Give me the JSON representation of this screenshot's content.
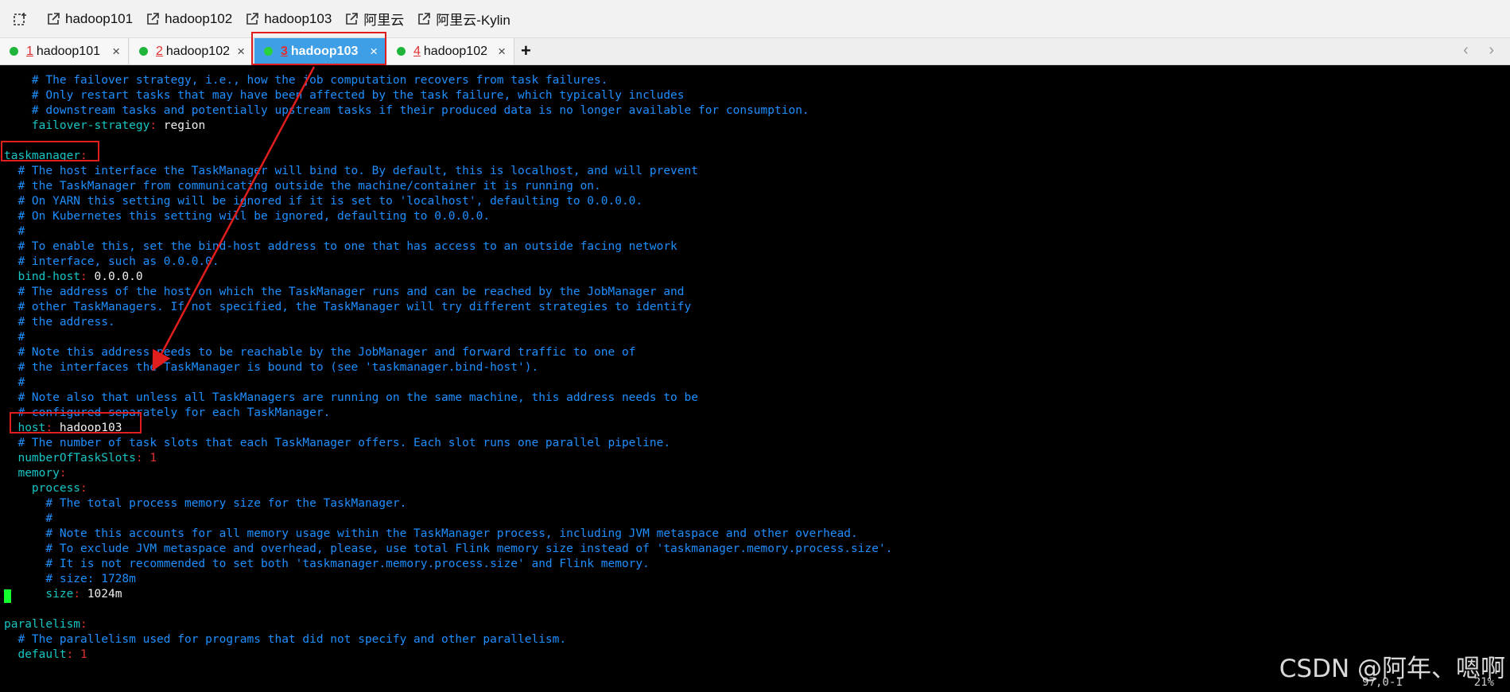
{
  "bookmarks": {
    "icon": "new-window-icon",
    "items": [
      "hadoop101",
      "hadoop102",
      "hadoop103",
      "阿里云",
      "阿里云-Kylin"
    ]
  },
  "tabs": [
    {
      "num": "1",
      "label": "hadoop101",
      "close": "×",
      "active": false
    },
    {
      "num": "2",
      "label": "hadoop102",
      "close": "×",
      "active": false
    },
    {
      "num": "3",
      "label": "hadoop103",
      "close": "×",
      "active": true
    },
    {
      "num": "4",
      "label": "hadoop102",
      "close": "×",
      "active": false
    }
  ],
  "tab_add": "+",
  "tab_nav": "‹ ›",
  "terminal_lines": [
    [
      [
        "cmt",
        "    # The failover strategy, i.e., how the job computation recovers from task failures."
      ]
    ],
    [
      [
        "cmt",
        "    # Only restart tasks that may have been affected by the task failure, which typically includes"
      ]
    ],
    [
      [
        "cmt",
        "    # downstream tasks and potentially upstream tasks if their produced data is no longer available for consumption."
      ]
    ],
    [
      [
        "key",
        "    failover-strategy"
      ],
      [
        "pun",
        ":"
      ],
      [
        "val",
        " region"
      ]
    ],
    [
      [
        "val",
        ""
      ]
    ],
    [
      [
        "key",
        "taskmanager"
      ],
      [
        "pun",
        ":"
      ]
    ],
    [
      [
        "cmt",
        "  # The host interface the TaskManager will bind to. By default, this is localhost, and will prevent"
      ]
    ],
    [
      [
        "cmt",
        "  # the TaskManager from communicating outside the machine/container it is running on."
      ]
    ],
    [
      [
        "cmt",
        "  # On YARN this setting will be ignored if it is set to 'localhost', defaulting to 0.0.0.0."
      ]
    ],
    [
      [
        "cmt",
        "  # On Kubernetes this setting will be ignored, defaulting to 0.0.0.0."
      ]
    ],
    [
      [
        "cmt",
        "  #"
      ]
    ],
    [
      [
        "cmt",
        "  # To enable this, set the bind-host address to one that has access to an outside facing network"
      ]
    ],
    [
      [
        "cmt",
        "  # interface, such as 0.0.0.0."
      ]
    ],
    [
      [
        "key",
        "  bind-host"
      ],
      [
        "pun",
        ":"
      ],
      [
        "val",
        " 0.0.0.0"
      ]
    ],
    [
      [
        "cmt",
        "  # The address of the host on which the TaskManager runs and can be reached by the JobManager and"
      ]
    ],
    [
      [
        "cmt",
        "  # other TaskManagers. If not specified, the TaskManager will try different strategies to identify"
      ]
    ],
    [
      [
        "cmt",
        "  # the address."
      ]
    ],
    [
      [
        "cmt",
        "  #"
      ]
    ],
    [
      [
        "cmt",
        "  # Note this address needs to be reachable by the JobManager and forward traffic to one of"
      ]
    ],
    [
      [
        "cmt",
        "  # the interfaces the TaskManager is bound to (see 'taskmanager.bind-host')."
      ]
    ],
    [
      [
        "cmt",
        "  #"
      ]
    ],
    [
      [
        "cmt",
        "  # Note also that unless all TaskManagers are running on the same machine, this address needs to be"
      ]
    ],
    [
      [
        "cmt",
        "  # configured separately for each TaskManager."
      ]
    ],
    [
      [
        "key",
        "  host"
      ],
      [
        "pun",
        ":"
      ],
      [
        "val",
        " hadoop103"
      ]
    ],
    [
      [
        "cmt",
        "  # The number of task slots that each TaskManager offers. Each slot runs one parallel pipeline."
      ]
    ],
    [
      [
        "key",
        "  numberOfTaskSlots"
      ],
      [
        "pun",
        ":"
      ],
      [
        "num",
        " 1"
      ]
    ],
    [
      [
        "key",
        "  memory"
      ],
      [
        "pun",
        ":"
      ]
    ],
    [
      [
        "key",
        "    process"
      ],
      [
        "pun",
        ":"
      ]
    ],
    [
      [
        "cmt",
        "      # The total process memory size for the TaskManager."
      ]
    ],
    [
      [
        "cmt",
        "      #"
      ]
    ],
    [
      [
        "cmt",
        "      # Note this accounts for all memory usage within the TaskManager process, including JVM metaspace and other overhead."
      ]
    ],
    [
      [
        "cmt",
        "      # To exclude JVM metaspace and overhead, please, use total Flink memory size instead of 'taskmanager.memory.process.size'."
      ]
    ],
    [
      [
        "cmt",
        "      # It is not recommended to set both 'taskmanager.memory.process.size' and Flink memory."
      ]
    ],
    [
      [
        "cmt",
        "      # size: 1728m"
      ]
    ],
    [
      [
        "key",
        "      size"
      ],
      [
        "pun",
        ":"
      ],
      [
        "val",
        " 1024m"
      ]
    ],
    [
      [
        "val",
        ""
      ]
    ],
    [
      [
        "key",
        "parallelism"
      ],
      [
        "pun",
        ":"
      ]
    ],
    [
      [
        "cmt",
        "  # The parallelism used for programs that did not specify and other parallelism."
      ]
    ],
    [
      [
        "key",
        "  default"
      ],
      [
        "pun",
        ":"
      ],
      [
        "num",
        " 1"
      ]
    ]
  ],
  "status": {
    "position": "97,0-1",
    "percent": "21%"
  },
  "watermark": "CSDN @阿年、嗯啊",
  "colors": {
    "comment": "#1e8fff",
    "key": "#17c5c5",
    "value": "#f0f0f0",
    "number": "#e23030",
    "active_tab": "#3e9ee6",
    "annotation": "#e01e1e",
    "cursor": "#14ff2e"
  }
}
